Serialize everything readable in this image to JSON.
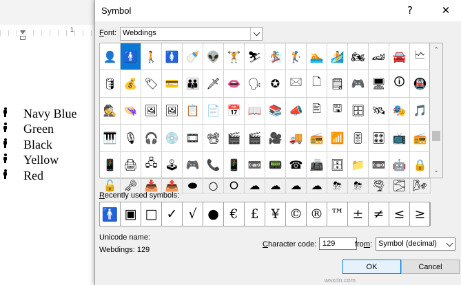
{
  "document": {
    "ruler_number": "1",
    "list_items": [
      {
        "label": "Navy Blue"
      },
      {
        "label": "Green"
      },
      {
        "label": "Black"
      },
      {
        "label": "Yellow"
      },
      {
        "label": "Red"
      }
    ]
  },
  "dialog": {
    "title": "Symbol",
    "help_button": "?",
    "close_button": "✕",
    "font_label": "Font:",
    "font_value": "Webdings",
    "symbols": [
      "👤",
      "🚹",
      "🚶",
      "🚺",
      "🍼",
      "👽",
      "🏋",
      "⛷",
      "🏂",
      "🏌",
      "🏊",
      "🏄",
      "🏍",
      "🏎",
      "🚘",
      "🗠",
      "🛢",
      "💰",
      "🏷",
      "💳",
      "👪",
      "🗡",
      "👄",
      "🗣",
      "✪",
      "🖂",
      "🗋",
      "🗒",
      "🎮",
      "🖥",
      "🛈",
      "🚇",
      "🕵",
      "👒",
      "🖼",
      "🖼",
      "📋",
      "📄",
      "📅",
      "📖",
      "📚",
      "📣",
      "🖹",
      "🖫",
      "🗄",
      "🛰",
      "🎭",
      "🎵",
      "🎹",
      "🎙",
      "🎧",
      "💿",
      "🎞",
      "📽",
      "🎬",
      "🎬",
      "🎥",
      "🚚",
      "📻",
      "📶",
      "🎚",
      "🎛",
      "📺",
      "📻",
      "📱",
      "🖨",
      "🖧",
      "🕹",
      "🎮",
      "📞",
      "📱",
      "📼",
      "📟",
      "☎",
      "📠",
      "🗄",
      "📁",
      "📼",
      "🤖",
      "🔒"
    ],
    "symbols_row5": [
      "🔓",
      "🗝",
      "📥",
      "📤",
      "⬬",
      "○",
      "⭘",
      "☁",
      "☁",
      "☁",
      "☁",
      "⛈",
      "⛈",
      "🌪",
      "🌫",
      "🌬"
    ],
    "recent_label": "Recently used symbols:",
    "recent_symbols": [
      "🚹",
      "▣",
      "□",
      "✓",
      "√",
      "●",
      "€",
      "£",
      "¥",
      "©",
      "®",
      "™",
      "±",
      "≠",
      "≤",
      "≥"
    ],
    "unicode_name_label": "Unicode name:",
    "unicode_name_value": "Webdings: 129",
    "char_code_label": "Character code:",
    "char_code_value": "129",
    "from_label": "from:",
    "from_value": "Symbol (decimal)",
    "ok_label": "OK",
    "cancel_label": "Cancel"
  },
  "watermark": "wsxdn.com",
  "colors": {
    "selection": "#0b78d7",
    "dialog_bg": "#f0f0f0"
  }
}
